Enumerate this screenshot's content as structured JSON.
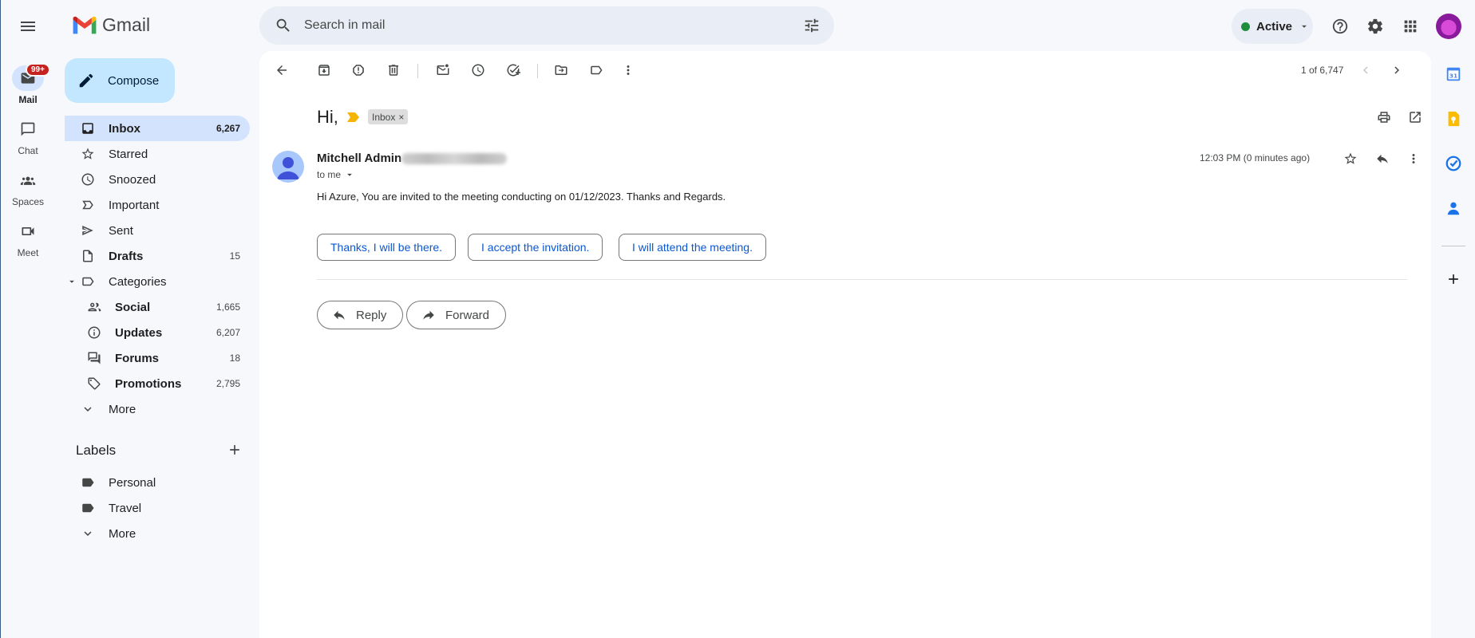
{
  "app": {
    "name": "Gmail"
  },
  "search": {
    "placeholder": "Search in mail"
  },
  "status": {
    "label": "Active"
  },
  "rail": {
    "mail": "Mail",
    "mail_badge": "99+",
    "chat": "Chat",
    "spaces": "Spaces",
    "meet": "Meet"
  },
  "compose": {
    "label": "Compose"
  },
  "nav": {
    "inbox": {
      "label": "Inbox",
      "count": "6,267"
    },
    "starred": {
      "label": "Starred"
    },
    "snoozed": {
      "label": "Snoozed"
    },
    "important": {
      "label": "Important"
    },
    "sent": {
      "label": "Sent"
    },
    "drafts": {
      "label": "Drafts",
      "count": "15"
    },
    "categories": {
      "label": "Categories"
    },
    "social": {
      "label": "Social",
      "count": "1,665"
    },
    "updates": {
      "label": "Updates",
      "count": "6,207"
    },
    "forums": {
      "label": "Forums",
      "count": "18"
    },
    "promotions": {
      "label": "Promotions",
      "count": "2,795"
    },
    "more": {
      "label": "More"
    }
  },
  "labels": {
    "title": "Labels",
    "items": [
      "Personal",
      "Travel"
    ],
    "more": "More"
  },
  "toolbar": {
    "pager": "1 of 6,747"
  },
  "email": {
    "subject": "Hi,",
    "label_chip": "Inbox",
    "sender_name": "Mitchell Admin",
    "to": "to me",
    "timestamp": "12:03 PM (0 minutes ago)",
    "body": "Hi Azure, You are invited to the meeting conducting on 01/12/2023. Thanks and Regards.",
    "smart_replies": [
      "Thanks, I will be there.",
      "I accept the invitation.",
      "I will attend the meeting."
    ],
    "reply": "Reply",
    "forward": "Forward"
  },
  "colors": {
    "accent": "#0b57d0",
    "active_nav": "#d3e3fd",
    "compose": "#c2e7ff",
    "badge": "#c5221f",
    "status_dot": "#1e8e3e",
    "label_marker": "#f4b400"
  }
}
